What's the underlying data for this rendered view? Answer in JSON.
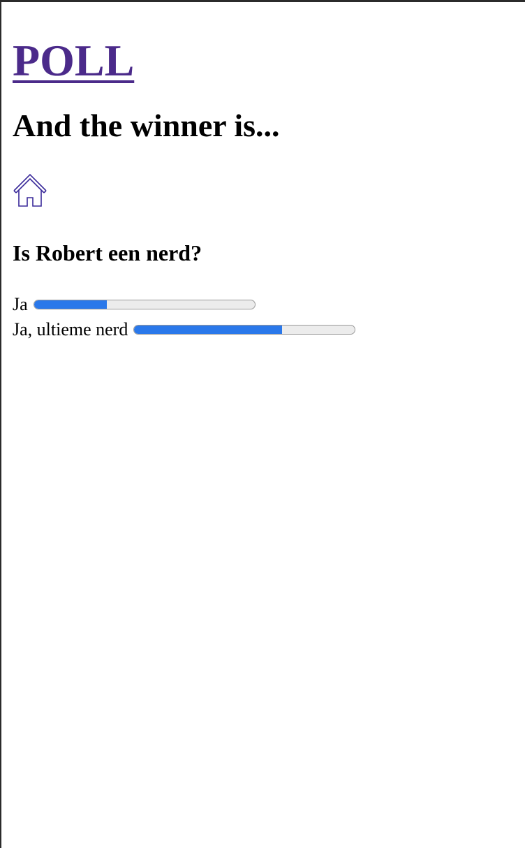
{
  "site": {
    "title": "POLL"
  },
  "page": {
    "headline": "And the winner is..."
  },
  "home_icon": "home-icon",
  "poll": {
    "question": "Is Robert een nerd?",
    "results": [
      {
        "label": "Ja",
        "fraction": 0.33
      },
      {
        "label": "Ja, ultieme nerd",
        "fraction": 0.67
      }
    ]
  },
  "colors": {
    "link": "#4b2a8a",
    "bar_fill": "#2a78ea",
    "bar_track": "#ececec"
  }
}
